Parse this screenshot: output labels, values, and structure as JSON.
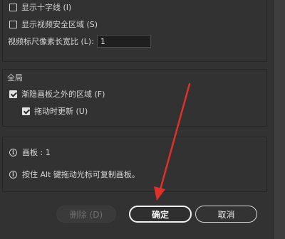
{
  "options": {
    "show_crosshair": {
      "label": "显示十字线 (I)",
      "checked": false
    },
    "show_video_safe": {
      "label": "显示视频安全区域 (S)",
      "checked": false
    },
    "pixel_ratio": {
      "label": "视频标尺像素长宽比 (L):",
      "value": "1"
    }
  },
  "global": {
    "title": "全局",
    "fade_outside": {
      "label": "渐隐画板之外的区域 (F)",
      "checked": true
    },
    "update_while_drag": {
      "label": "拖动时更新 (U)",
      "checked": true
    }
  },
  "info": {
    "artboards": "画板 : 1",
    "tip": "按住 Alt 键拖动光标可复制画板。"
  },
  "buttons": {
    "delete": "删除 (D)",
    "ok": "确定",
    "cancel": "取消"
  },
  "colors": {
    "annotation_arrow": "#e0302a"
  }
}
